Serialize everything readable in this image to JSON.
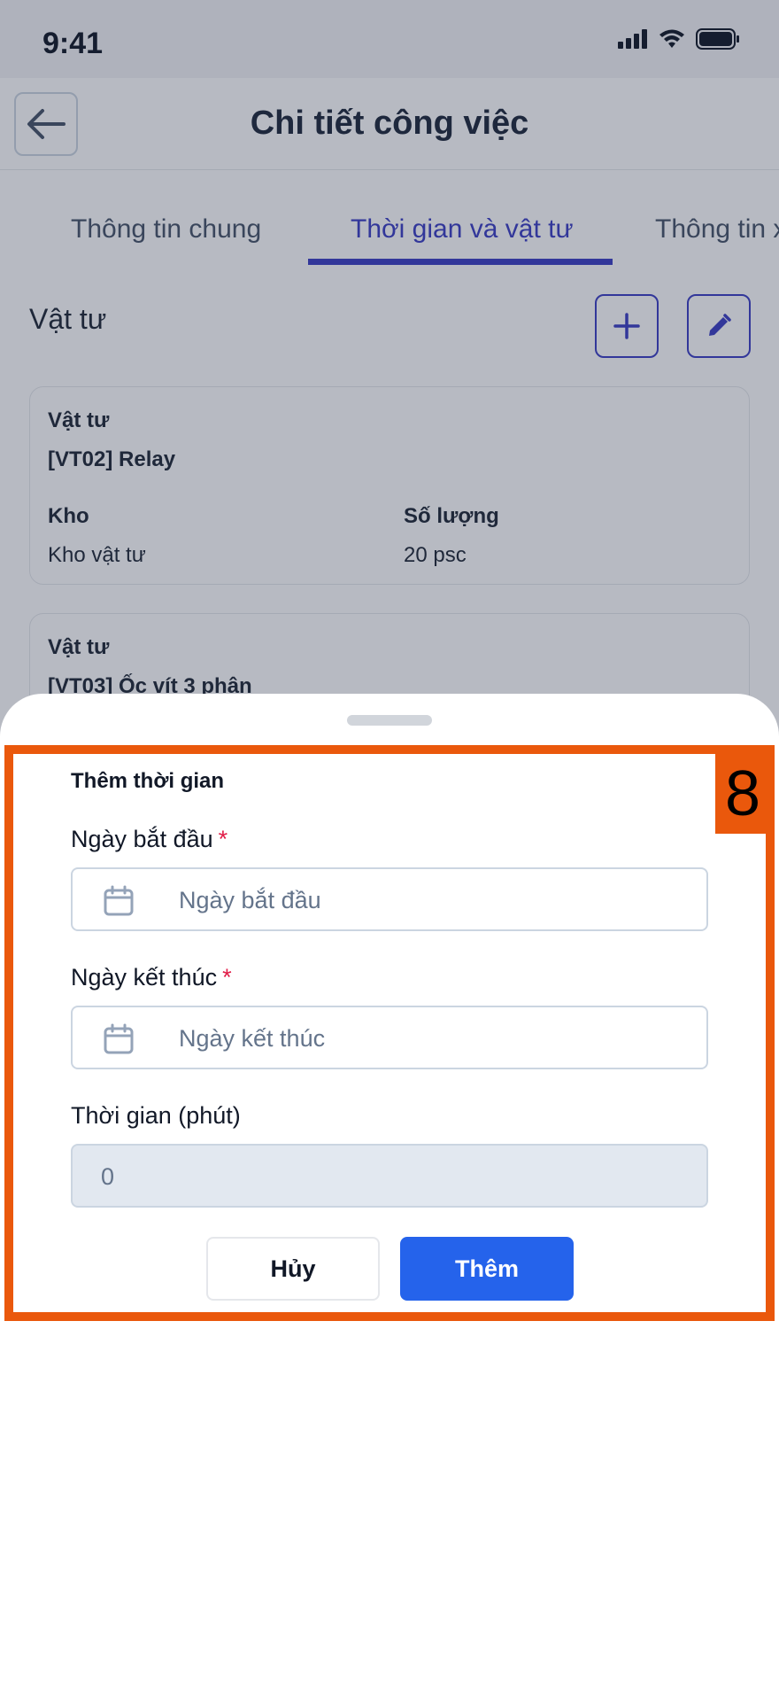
{
  "status_bar": {
    "time": "9:41"
  },
  "header": {
    "title": "Chi tiết công việc"
  },
  "tabs": [
    {
      "label": "Thông tin chung",
      "active": false
    },
    {
      "label": "Thời gian và vật tư",
      "active": true
    },
    {
      "label": "Thông tin x",
      "active": false
    }
  ],
  "materials_section": {
    "title": "Vật tư"
  },
  "cards": [
    {
      "material_label": "Vật tư",
      "material_value": "[VT02] Relay",
      "warehouse_label": "Kho",
      "warehouse_value": "Kho vật tư",
      "quantity_label": "Số lượng",
      "quantity_value": "20 psc"
    },
    {
      "material_label": "Vật tư",
      "material_value": "[VT03] Ốc vít 3 phân"
    }
  ],
  "sheet": {
    "title": "Thêm thời gian",
    "start_date": {
      "label": "Ngày bắt đầu",
      "required_mark": "*",
      "placeholder": "Ngày bắt đầu"
    },
    "end_date": {
      "label": "Ngày kết thúc",
      "required_mark": "*",
      "placeholder": "Ngày kết thúc"
    },
    "duration": {
      "label": "Thời gian (phút)",
      "value": "0"
    },
    "cancel_label": "Hủy",
    "add_label": "Thêm"
  },
  "highlight": {
    "tag": "8",
    "color": "#ea580c"
  },
  "colors": {
    "accent": "#3b3fc4",
    "primary_button": "#2563eb",
    "required": "#e11d48"
  },
  "icons": [
    "back-arrow-icon",
    "plus-icon",
    "pencil-icon",
    "calendar-icon",
    "signal-icon",
    "wifi-icon",
    "battery-icon"
  ]
}
